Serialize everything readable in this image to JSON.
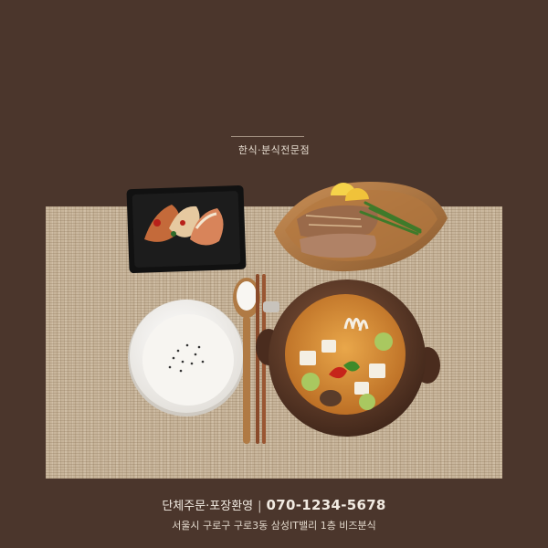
{
  "header": {
    "tagline": "한식·분식전문점"
  },
  "footer": {
    "order_text": "단체주문·포장환영",
    "separator": "|",
    "phone": "070-1234-5678",
    "address": "서울시 구로구 구로3동 삼성IT밸리 1층 비즈분식"
  },
  "colors": {
    "background": "#4b362c",
    "mat": "#c8b59b",
    "text": "#f2ebe2"
  }
}
